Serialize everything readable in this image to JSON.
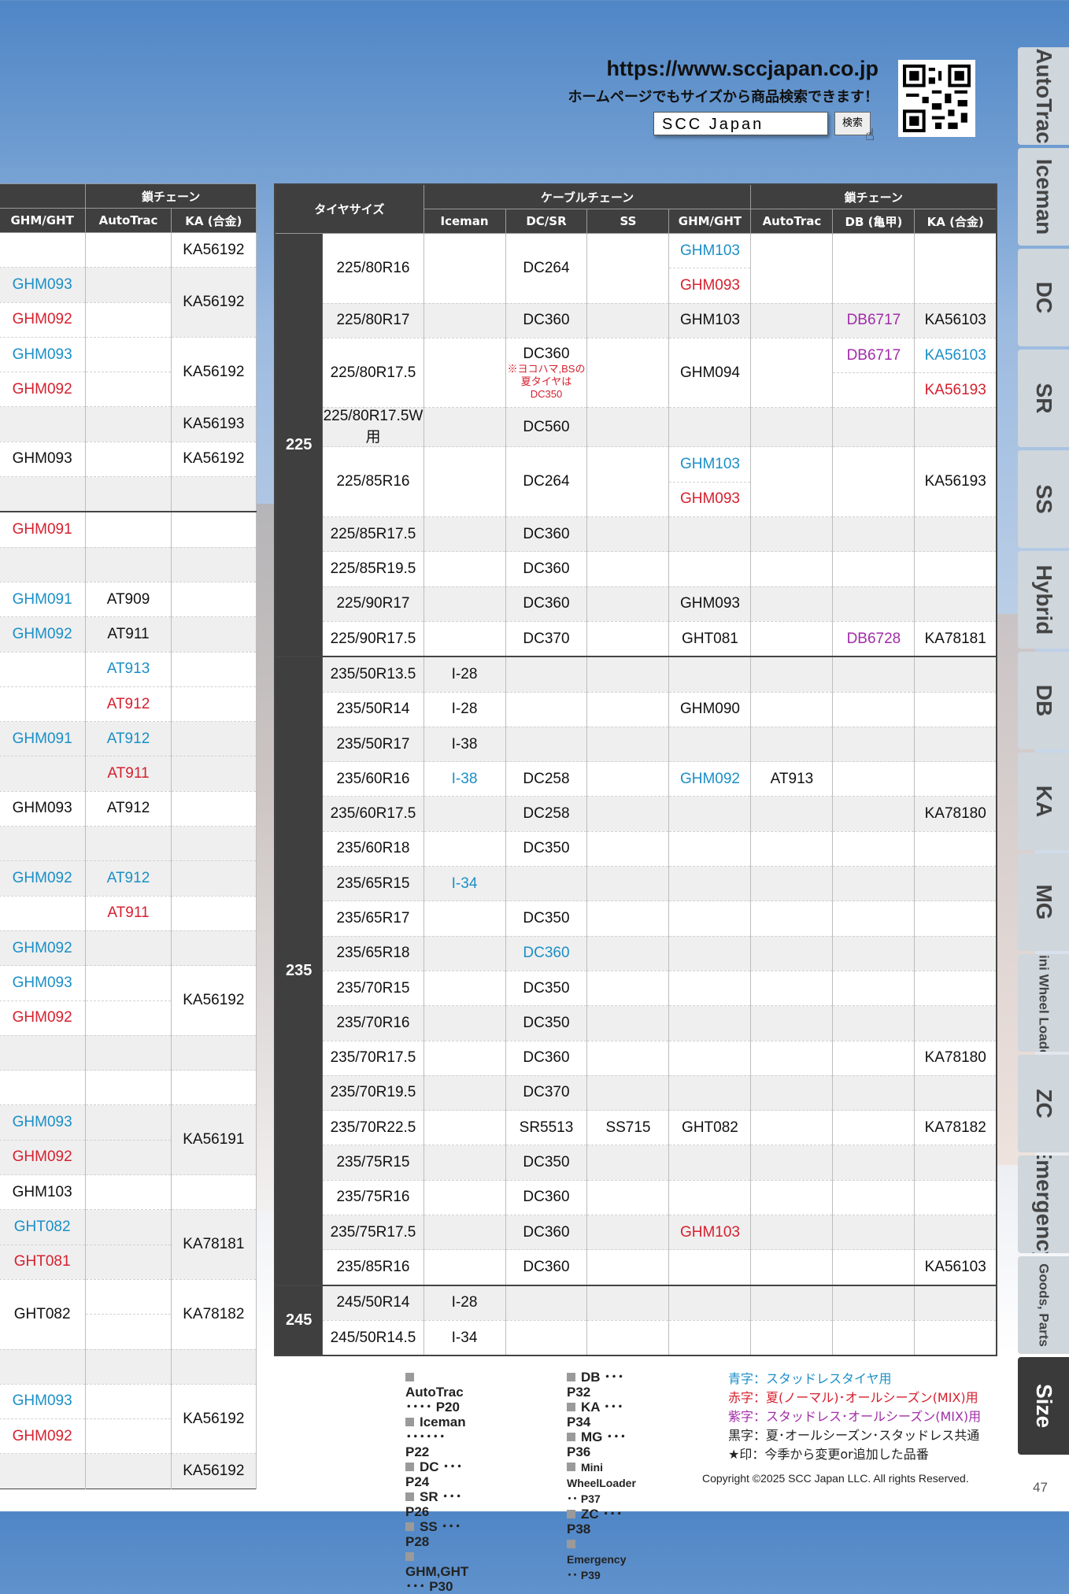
{
  "header": {
    "url": "https://www.sccjapan.co.jp",
    "subtitle": "ホームページでもサイズから商品検索できます！",
    "search_value": "SCC Japan",
    "search_button": "検索"
  },
  "colors": {
    "blue": "#1a8fc7",
    "red": "#d6202e",
    "purple": "#a12da8",
    "black": "#111111"
  },
  "left_table": {
    "group_header": "鎖チェーン",
    "columns": [
      "GHM/GHT",
      "AutoTrac",
      "KA (合金)"
    ],
    "rows": [
      {
        "g": 0,
        "c": [
          [
            "",
            ""
          ],
          [
            "",
            ""
          ],
          [
            "KA56192",
            "black"
          ]
        ]
      },
      {
        "g": 1,
        "c": [
          [
            "GHM093",
            "blue"
          ],
          [
            "",
            ""
          ],
          [
            "KA56192",
            "black",
            2
          ]
        ]
      },
      {
        "g": 0,
        "c": [
          [
            "GHM092",
            "red"
          ],
          [
            "",
            ""
          ]
        ]
      },
      {
        "g": 0,
        "c": [
          [
            "GHM093",
            "blue"
          ],
          [
            "",
            ""
          ],
          [
            "KA56192",
            "black",
            2
          ]
        ]
      },
      {
        "g": 0,
        "c": [
          [
            "GHM092",
            "red"
          ],
          [
            "",
            ""
          ]
        ]
      },
      {
        "g": 1,
        "c": [
          [
            "",
            ""
          ],
          [
            "",
            ""
          ],
          [
            "KA56193",
            "black"
          ]
        ]
      },
      {
        "g": 0,
        "c": [
          [
            "GHM093",
            "black"
          ],
          [
            "",
            ""
          ],
          [
            "KA56192",
            "black"
          ]
        ]
      },
      {
        "g": 1,
        "c": [
          [
            "",
            ""
          ],
          [
            "",
            ""
          ],
          [
            "",
            ""
          ]
        ]
      },
      {
        "g": 0,
        "sep": 1,
        "c": [
          [
            "GHM091",
            "red"
          ],
          [
            "",
            ""
          ],
          [
            "",
            ""
          ]
        ]
      },
      {
        "g": 1,
        "c": [
          [
            "",
            ""
          ],
          [
            "",
            ""
          ],
          [
            "",
            ""
          ]
        ]
      },
      {
        "g": 0,
        "c": [
          [
            "GHM091",
            "blue"
          ],
          [
            "AT909",
            "black"
          ],
          [
            "",
            ""
          ]
        ]
      },
      {
        "g": 1,
        "c": [
          [
            "GHM092",
            "blue"
          ],
          [
            "AT911",
            "black"
          ],
          [
            "",
            ""
          ]
        ]
      },
      {
        "g": 0,
        "c": [
          [
            "",
            ""
          ],
          [
            "AT913",
            "blue"
          ],
          [
            "",
            ""
          ]
        ]
      },
      {
        "g": 0,
        "c": [
          [
            "",
            ""
          ],
          [
            "AT912",
            "red"
          ],
          [
            "",
            ""
          ]
        ]
      },
      {
        "g": 1,
        "c": [
          [
            "GHM091",
            "blue"
          ],
          [
            "AT912",
            "blue"
          ],
          [
            "",
            ""
          ]
        ]
      },
      {
        "g": 1,
        "c": [
          [
            "",
            ""
          ],
          [
            "AT911",
            "red"
          ],
          [
            "",
            ""
          ]
        ]
      },
      {
        "g": 0,
        "c": [
          [
            "GHM093",
            "black"
          ],
          [
            "AT912",
            "black"
          ],
          [
            "",
            ""
          ]
        ]
      },
      {
        "g": 1,
        "c": [
          [
            "",
            ""
          ],
          [
            "",
            ""
          ],
          [
            "",
            ""
          ]
        ]
      },
      {
        "g": 1,
        "c": [
          [
            "GHM092",
            "blue"
          ],
          [
            "AT912",
            "blue"
          ],
          [
            "",
            ""
          ]
        ]
      },
      {
        "g": 0,
        "c": [
          [
            "",
            ""
          ],
          [
            "AT911",
            "red"
          ],
          [
            "",
            ""
          ]
        ]
      },
      {
        "g": 1,
        "c": [
          [
            "GHM092",
            "blue"
          ],
          [
            "",
            ""
          ],
          [
            "",
            ""
          ]
        ]
      },
      {
        "g": 0,
        "c": [
          [
            "GHM093",
            "blue"
          ],
          [
            "",
            ""
          ],
          [
            "KA56192",
            "black",
            2
          ]
        ]
      },
      {
        "g": 0,
        "c": [
          [
            "GHM092",
            "red"
          ],
          [
            "",
            ""
          ]
        ]
      },
      {
        "g": 1,
        "c": [
          [
            "",
            ""
          ],
          [
            "",
            ""
          ],
          [
            "",
            ""
          ]
        ]
      },
      {
        "g": 0,
        "c": [
          [
            "",
            ""
          ],
          [
            "",
            ""
          ],
          [
            "",
            ""
          ]
        ]
      },
      {
        "g": 1,
        "c": [
          [
            "GHM093",
            "blue"
          ],
          [
            "",
            ""
          ],
          [
            "KA56191",
            "black",
            2
          ]
        ]
      },
      {
        "g": 1,
        "c": [
          [
            "GHM092",
            "red"
          ],
          [
            "",
            ""
          ]
        ]
      },
      {
        "g": 0,
        "c": [
          [
            "GHM103",
            "black"
          ],
          [
            "",
            ""
          ],
          [
            "",
            ""
          ]
        ]
      },
      {
        "g": 1,
        "c": [
          [
            "GHT082",
            "blue"
          ],
          [
            "",
            ""
          ],
          [
            "KA78181",
            "black",
            2
          ]
        ]
      },
      {
        "g": 1,
        "c": [
          [
            "GHT081",
            "red"
          ],
          [
            "",
            ""
          ]
        ]
      },
      {
        "g": 0,
        "c": [
          [
            "GHT082",
            "black",
            2
          ],
          [
            "",
            ""
          ],
          [
            "KA78182",
            "black",
            2
          ]
        ]
      },
      {
        "g": 0,
        "c": [
          [
            "",
            ""
          ]
        ]
      },
      {
        "g": 1,
        "c": [
          [
            "",
            ""
          ],
          [
            "",
            ""
          ],
          [
            "",
            ""
          ]
        ]
      },
      {
        "g": 0,
        "c": [
          [
            "GHM093",
            "blue"
          ],
          [
            "",
            ""
          ],
          [
            "KA56192",
            "black",
            2
          ]
        ]
      },
      {
        "g": 0,
        "c": [
          [
            "GHM092",
            "red"
          ],
          [
            "",
            ""
          ]
        ]
      },
      {
        "g": 1,
        "c": [
          [
            "",
            ""
          ],
          [
            "",
            ""
          ],
          [
            "KA56192",
            "black"
          ]
        ]
      }
    ]
  },
  "main_table": {
    "header": {
      "tire_size": "タイヤサイズ",
      "cable_chain": "ケーブルチェーン",
      "chain": "鎖チェーン",
      "columns": [
        "Iceman",
        "DC/SR",
        "SS",
        "GHM/GHT",
        "AutoTrac",
        "DB (亀甲)",
        "KA (合金)"
      ]
    },
    "groups": [
      {
        "label": "225",
        "rows": [
          {
            "size": "225/80R16",
            "span": 2,
            "g": 0,
            "c": {
              "dc": "DC264",
              "dcspan": 2,
              "ghm": [
                "GHM103",
                "blue"
              ]
            }
          },
          {
            "g": 0,
            "c": {
              "ghm": [
                "GHM093",
                "red"
              ]
            }
          },
          {
            "size": "225/80R17",
            "g": 1,
            "c": {
              "dc": "DC360",
              "ghm": [
                "GHM103",
                "black"
              ],
              "db": [
                "DB6717",
                "purple"
              ],
              "ka": [
                "KA56103",
                "black"
              ]
            }
          },
          {
            "size": "225/80R17.5",
            "span": 2,
            "g": 0,
            "c": {
              "dc": "DC360",
              "dcnote": "※ヨコハマ,BSの夏タイヤはDC350",
              "dcspan": 2,
              "ghm": [
                "GHM094",
                "black"
              ],
              "ghmspan": 2,
              "db": [
                "DB6717",
                "purple"
              ],
              "ka": [
                "KA56103",
                "blue"
              ]
            }
          },
          {
            "g": 0,
            "c": {
              "db": [
                "",
                ""
              ],
              "ka": [
                "KA56193",
                "red"
              ]
            }
          },
          {
            "size": "225/80R17.5W用",
            "g": 1,
            "c": {
              "dc": "DC560"
            }
          },
          {
            "size": "225/85R16",
            "span": 2,
            "g": 0,
            "c": {
              "dc": "DC264",
              "dcspan": 2,
              "ghm": [
                "GHM103",
                "blue"
              ],
              "ka": [
                "KA56193",
                "black"
              ],
              "kaspan": 2
            }
          },
          {
            "g": 0,
            "c": {
              "ghm": [
                "GHM093",
                "red"
              ]
            }
          },
          {
            "size": "225/85R17.5",
            "g": 1,
            "c": {
              "dc": "DC360"
            }
          },
          {
            "size": "225/85R19.5",
            "g": 0,
            "c": {
              "dc": "DC360"
            }
          },
          {
            "size": "225/90R17",
            "g": 1,
            "c": {
              "dc": "DC360",
              "ghm": [
                "GHM093",
                "black"
              ]
            }
          },
          {
            "size": "225/90R17.5",
            "g": 0,
            "c": {
              "dc": "DC370",
              "ghm": [
                "GHT081",
                "black"
              ],
              "db": [
                "DB6728",
                "purple"
              ],
              "ka": [
                "KA78181",
                "black"
              ]
            }
          }
        ]
      },
      {
        "label": "235",
        "rows": [
          {
            "size": "235/50R13.5",
            "g": 1,
            "c": {
              "ice": [
                "I-28",
                "black"
              ]
            }
          },
          {
            "size": "235/50R14",
            "g": 0,
            "c": {
              "ice": [
                "I-28",
                "black"
              ],
              "ghm": [
                "GHM090",
                "black"
              ]
            }
          },
          {
            "size": "235/50R17",
            "g": 1,
            "c": {
              "ice": [
                "I-38",
                "black"
              ]
            }
          },
          {
            "size": "235/60R16",
            "g": 0,
            "c": {
              "ice": [
                "I-38",
                "blue"
              ],
              "dc": "DC258",
              "ghm": [
                "GHM092",
                "blue"
              ],
              "at": [
                "AT913",
                "black"
              ]
            }
          },
          {
            "size": "235/60R17.5",
            "g": 1,
            "c": {
              "dc": "DC258",
              "ka": [
                "KA78180",
                "black"
              ]
            }
          },
          {
            "size": "235/60R18",
            "g": 0,
            "c": {
              "dc": "DC350"
            }
          },
          {
            "size": "235/65R15",
            "g": 1,
            "c": {
              "ice": [
                "I-34",
                "blue"
              ]
            }
          },
          {
            "size": "235/65R17",
            "g": 0,
            "c": {
              "dc": "DC350"
            }
          },
          {
            "size": "235/65R18",
            "g": 1,
            "c": {
              "dc": "DC360",
              "dccolor": "blue"
            }
          },
          {
            "size": "235/70R15",
            "g": 0,
            "c": {
              "dc": "DC350"
            }
          },
          {
            "size": "235/70R16",
            "g": 1,
            "c": {
              "dc": "DC350"
            }
          },
          {
            "size": "235/70R17.5",
            "g": 0,
            "c": {
              "dc": "DC360",
              "ka": [
                "KA78180",
                "black"
              ]
            }
          },
          {
            "size": "235/70R19.5",
            "g": 1,
            "c": {
              "dc": "DC370"
            }
          },
          {
            "size": "235/70R22.5",
            "g": 0,
            "c": {
              "dc": "SR5513",
              "ss": "SS715",
              "ghm": [
                "GHT082",
                "black"
              ],
              "ka": [
                "KA78182",
                "black"
              ]
            }
          },
          {
            "size": "235/75R15",
            "g": 1,
            "c": {
              "dc": "DC350"
            }
          },
          {
            "size": "235/75R16",
            "g": 0,
            "c": {
              "dc": "DC360"
            }
          },
          {
            "size": "235/75R17.5",
            "g": 1,
            "c": {
              "dc": "DC360",
              "ghm": [
                "GHM103",
                "red"
              ]
            }
          },
          {
            "size": "235/85R16",
            "g": 0,
            "c": {
              "dc": "DC360",
              "ka": [
                "KA56103",
                "black"
              ]
            }
          }
        ]
      },
      {
        "label": "245",
        "rows": [
          {
            "size": "245/50R14",
            "g": 1,
            "c": {
              "ice": [
                "I-28",
                "black"
              ]
            }
          },
          {
            "size": "245/50R14.5",
            "g": 0,
            "c": {
              "ice": [
                "I-34",
                "black"
              ]
            }
          }
        ]
      }
    ]
  },
  "side_tabs": [
    "AutoTrac",
    "Iceman",
    "DC",
    "SR",
    "SS",
    "Hybrid",
    "DB",
    "KA",
    "MG",
    "Mini Wheel Loader",
    "ZC",
    "Emergency",
    "Goods, Parts",
    "Size"
  ],
  "legend": {
    "col1": [
      "AutoTrac ････ P20",
      "Iceman ･･････ P22",
      "DC ･･･ P24",
      "SR ･･･ P26",
      "SS ･･･ P28",
      "GHM,GHT ･･･ P30"
    ],
    "col2": [
      "DB ･･･ P32",
      "KA ･･･ P34",
      "MG ･･･ P36",
      "Mini WheelLoader ･･ P37",
      "ZC ･･･ P38",
      "Emergency ･･ P39"
    ],
    "colors": [
      {
        "text": "青字：スタッドレスタイヤ用",
        "color": "#1a8fc7"
      },
      {
        "text": "赤字：夏(ノーマル)･オールシーズン(MIX)用",
        "color": "#d6202e"
      },
      {
        "text": "紫字：スタッドレス･オールシーズン(MIX)用",
        "color": "#a12da8"
      },
      {
        "text": "黒字：夏･オールシーズン･スタッドレス共通",
        "color": "#222222"
      },
      {
        "text": "★印：今季から変更or追加した品番",
        "color": "#222222"
      }
    ]
  },
  "copyright": "Copyright ©2025 SCC Japan LLC. All rights Reserved.",
  "page_number": "47"
}
